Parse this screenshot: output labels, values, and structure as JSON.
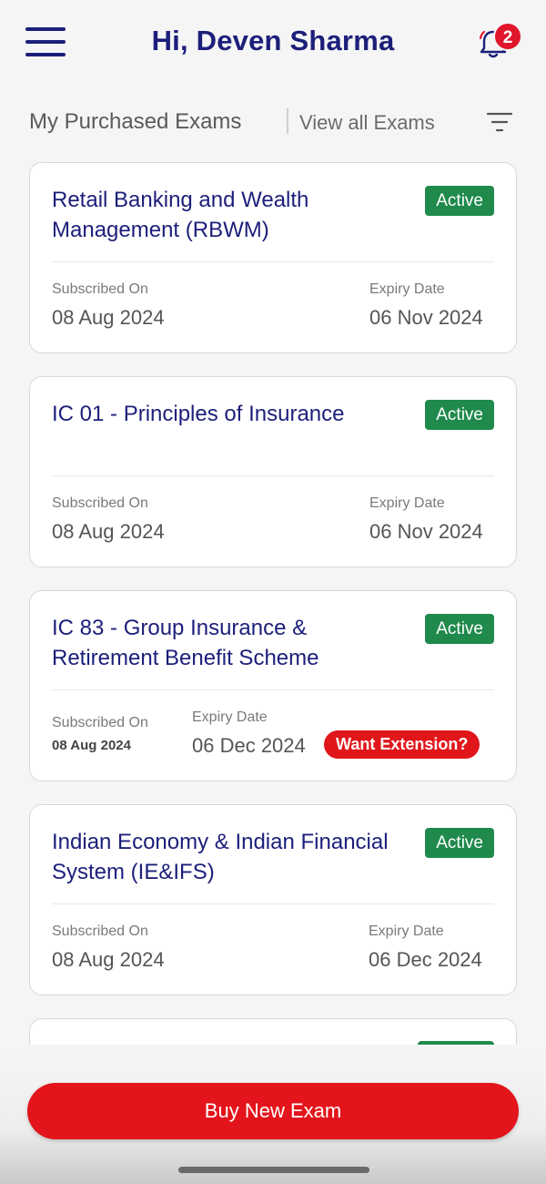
{
  "header": {
    "greeting": "Hi, Deven Sharma",
    "notification_count": "2",
    "menu_icon": "hamburger-menu-icon",
    "bell_icon": "bell-icon"
  },
  "subheader": {
    "title": "My Purchased Exams",
    "view_all": "View all Exams",
    "filter_icon": "filter-icon"
  },
  "labels": {
    "subscribed_on": "Subscribed On",
    "expiry_date": "Expiry Date"
  },
  "exams": [
    {
      "title": "Retail Banking and Wealth Management (RBWM)",
      "status": "Active",
      "subscribed_on": "08 Aug 2024",
      "expiry_date": "06 Nov 2024"
    },
    {
      "title": "IC 01 - Principles of Insurance",
      "status": "Active",
      "subscribed_on": "08 Aug 2024",
      "expiry_date": "06 Nov 2024"
    },
    {
      "title": "IC 83 - Group Insurance & Retirement Benefit Scheme",
      "status": "Active",
      "subscribed_on": "08 Aug 2024",
      "expiry_date": "06 Dec 2024",
      "extension_label": "Want Extension?"
    },
    {
      "title": "Indian Economy & Indian Financial System (IE&IFS)",
      "status": "Active",
      "subscribed_on": "08 Aug 2024",
      "expiry_date": "06 Dec 2024"
    }
  ],
  "footer": {
    "buy_button": "Buy New Exam"
  },
  "colors": {
    "brand_navy": "#1c1f7a",
    "active_green": "#1f8a4c",
    "action_red": "#e3141b"
  }
}
